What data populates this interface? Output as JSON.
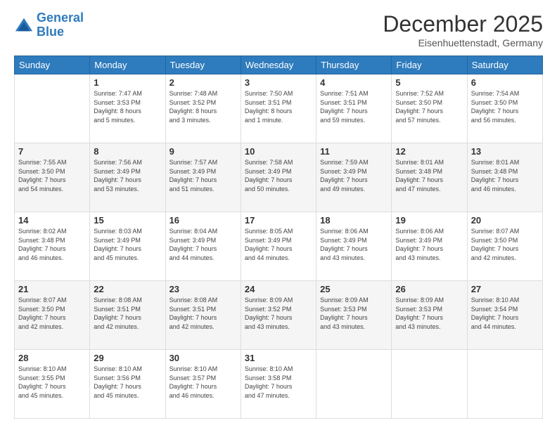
{
  "logo": {
    "line1": "General",
    "line2": "Blue"
  },
  "header": {
    "title": "December 2025",
    "location": "Eisenhuettenstadt, Germany"
  },
  "weekdays": [
    "Sunday",
    "Monday",
    "Tuesday",
    "Wednesday",
    "Thursday",
    "Friday",
    "Saturday"
  ],
  "weeks": [
    [
      {
        "day": "",
        "info": ""
      },
      {
        "day": "1",
        "info": "Sunrise: 7:47 AM\nSunset: 3:53 PM\nDaylight: 8 hours\nand 5 minutes."
      },
      {
        "day": "2",
        "info": "Sunrise: 7:48 AM\nSunset: 3:52 PM\nDaylight: 8 hours\nand 3 minutes."
      },
      {
        "day": "3",
        "info": "Sunrise: 7:50 AM\nSunset: 3:51 PM\nDaylight: 8 hours\nand 1 minute."
      },
      {
        "day": "4",
        "info": "Sunrise: 7:51 AM\nSunset: 3:51 PM\nDaylight: 7 hours\nand 59 minutes."
      },
      {
        "day": "5",
        "info": "Sunrise: 7:52 AM\nSunset: 3:50 PM\nDaylight: 7 hours\nand 57 minutes."
      },
      {
        "day": "6",
        "info": "Sunrise: 7:54 AM\nSunset: 3:50 PM\nDaylight: 7 hours\nand 56 minutes."
      }
    ],
    [
      {
        "day": "7",
        "info": "Sunrise: 7:55 AM\nSunset: 3:50 PM\nDaylight: 7 hours\nand 54 minutes."
      },
      {
        "day": "8",
        "info": "Sunrise: 7:56 AM\nSunset: 3:49 PM\nDaylight: 7 hours\nand 53 minutes."
      },
      {
        "day": "9",
        "info": "Sunrise: 7:57 AM\nSunset: 3:49 PM\nDaylight: 7 hours\nand 51 minutes."
      },
      {
        "day": "10",
        "info": "Sunrise: 7:58 AM\nSunset: 3:49 PM\nDaylight: 7 hours\nand 50 minutes."
      },
      {
        "day": "11",
        "info": "Sunrise: 7:59 AM\nSunset: 3:49 PM\nDaylight: 7 hours\nand 49 minutes."
      },
      {
        "day": "12",
        "info": "Sunrise: 8:01 AM\nSunset: 3:48 PM\nDaylight: 7 hours\nand 47 minutes."
      },
      {
        "day": "13",
        "info": "Sunrise: 8:01 AM\nSunset: 3:48 PM\nDaylight: 7 hours\nand 46 minutes."
      }
    ],
    [
      {
        "day": "14",
        "info": "Sunrise: 8:02 AM\nSunset: 3:48 PM\nDaylight: 7 hours\nand 46 minutes."
      },
      {
        "day": "15",
        "info": "Sunrise: 8:03 AM\nSunset: 3:49 PM\nDaylight: 7 hours\nand 45 minutes."
      },
      {
        "day": "16",
        "info": "Sunrise: 8:04 AM\nSunset: 3:49 PM\nDaylight: 7 hours\nand 44 minutes."
      },
      {
        "day": "17",
        "info": "Sunrise: 8:05 AM\nSunset: 3:49 PM\nDaylight: 7 hours\nand 44 minutes."
      },
      {
        "day": "18",
        "info": "Sunrise: 8:06 AM\nSunset: 3:49 PM\nDaylight: 7 hours\nand 43 minutes."
      },
      {
        "day": "19",
        "info": "Sunrise: 8:06 AM\nSunset: 3:49 PM\nDaylight: 7 hours\nand 43 minutes."
      },
      {
        "day": "20",
        "info": "Sunrise: 8:07 AM\nSunset: 3:50 PM\nDaylight: 7 hours\nand 42 minutes."
      }
    ],
    [
      {
        "day": "21",
        "info": "Sunrise: 8:07 AM\nSunset: 3:50 PM\nDaylight: 7 hours\nand 42 minutes."
      },
      {
        "day": "22",
        "info": "Sunrise: 8:08 AM\nSunset: 3:51 PM\nDaylight: 7 hours\nand 42 minutes."
      },
      {
        "day": "23",
        "info": "Sunrise: 8:08 AM\nSunset: 3:51 PM\nDaylight: 7 hours\nand 42 minutes."
      },
      {
        "day": "24",
        "info": "Sunrise: 8:09 AM\nSunset: 3:52 PM\nDaylight: 7 hours\nand 43 minutes."
      },
      {
        "day": "25",
        "info": "Sunrise: 8:09 AM\nSunset: 3:53 PM\nDaylight: 7 hours\nand 43 minutes."
      },
      {
        "day": "26",
        "info": "Sunrise: 8:09 AM\nSunset: 3:53 PM\nDaylight: 7 hours\nand 43 minutes."
      },
      {
        "day": "27",
        "info": "Sunrise: 8:10 AM\nSunset: 3:54 PM\nDaylight: 7 hours\nand 44 minutes."
      }
    ],
    [
      {
        "day": "28",
        "info": "Sunrise: 8:10 AM\nSunset: 3:55 PM\nDaylight: 7 hours\nand 45 minutes."
      },
      {
        "day": "29",
        "info": "Sunrise: 8:10 AM\nSunset: 3:56 PM\nDaylight: 7 hours\nand 45 minutes."
      },
      {
        "day": "30",
        "info": "Sunrise: 8:10 AM\nSunset: 3:57 PM\nDaylight: 7 hours\nand 46 minutes."
      },
      {
        "day": "31",
        "info": "Sunrise: 8:10 AM\nSunset: 3:58 PM\nDaylight: 7 hours\nand 47 minutes."
      },
      {
        "day": "",
        "info": ""
      },
      {
        "day": "",
        "info": ""
      },
      {
        "day": "",
        "info": ""
      }
    ]
  ]
}
